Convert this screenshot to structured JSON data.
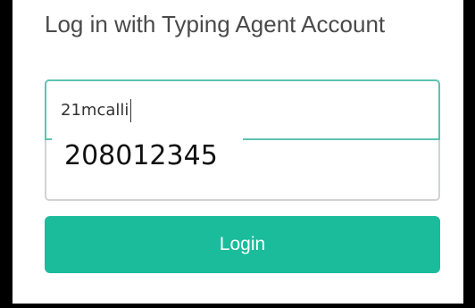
{
  "header": {
    "title": "Log in with Typing Agent Account"
  },
  "form": {
    "username_value": "21mcalli",
    "autofill_suggestion": "208012345",
    "login_label": "Login"
  },
  "colors": {
    "accent": "#1abc9c",
    "focus_border": "#5cc3b0"
  }
}
